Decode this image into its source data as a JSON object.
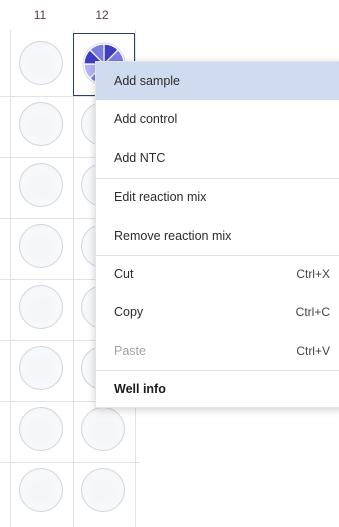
{
  "columns": [
    "11",
    "12"
  ],
  "selected_well": {
    "column": "12",
    "row": 1,
    "pie_colors": [
      "#3f3ec2",
      "#7c7ce3",
      "#b4b5f3"
    ]
  },
  "context_menu": {
    "items": [
      {
        "label": "Add sample",
        "shortcut": "",
        "state": "highlighted"
      },
      {
        "label": "Add control",
        "shortcut": "",
        "state": "normal"
      },
      {
        "label": "Add NTC",
        "shortcut": "",
        "state": "normal"
      },
      {
        "label": "Edit reaction mix",
        "shortcut": "",
        "state": "normal"
      },
      {
        "label": "Remove reaction mix",
        "shortcut": "",
        "state": "normal"
      },
      {
        "label": "Cut",
        "shortcut": "Ctrl+X",
        "state": "normal"
      },
      {
        "label": "Copy",
        "shortcut": "Ctrl+C",
        "state": "normal"
      },
      {
        "label": "Paste",
        "shortcut": "Ctrl+V",
        "state": "disabled"
      },
      {
        "label": "Well info",
        "shortcut": "",
        "state": "bold"
      }
    ]
  },
  "colors": {
    "highlight": "#cfdcef",
    "selection_border": "#2a3f7a",
    "header_text": "#5a3b4d"
  }
}
